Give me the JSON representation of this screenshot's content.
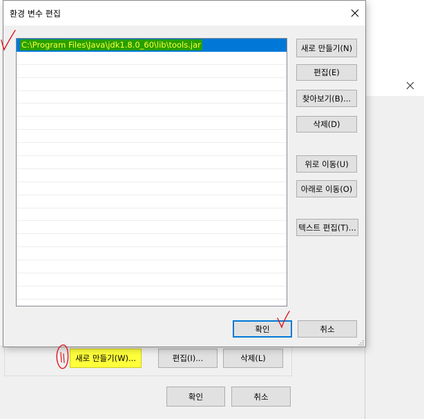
{
  "background_window": {
    "new_button": "새로 만들기(W)...",
    "edit_button": "편집(I)...",
    "delete_button": "삭제(L)",
    "ok_button": "확인",
    "cancel_button": "취소"
  },
  "dialog": {
    "title": "환경 변수 편집",
    "entries": [
      "C:\\Program Files\\Java\\jdk1.8.0_60\\lib\\tools.jar"
    ],
    "selected_index": 0,
    "buttons": {
      "new": "새로 만들기(N)",
      "edit": "편집(E)",
      "browse": "찾아보기(B)...",
      "delete": "삭제(D)",
      "move_up": "위로 이동(U)",
      "move_down": "아래로 이동(O)",
      "edit_text": "텍스트 편집(T)...",
      "ok": "확인",
      "cancel": "취소"
    }
  },
  "annotations": {
    "pen_color": "#e0141e",
    "highlight_color": "#ffff3a"
  },
  "colors": {
    "selection": "#0078d7",
    "entry_text_highlight_bg": "#26a000",
    "entry_text_color": "#ffff3a",
    "dialog_bg": "#f0f0f0"
  },
  "icons": {
    "dialog_close": "close-icon",
    "background_close": "close-icon",
    "resize": "resize-grip-icon"
  }
}
